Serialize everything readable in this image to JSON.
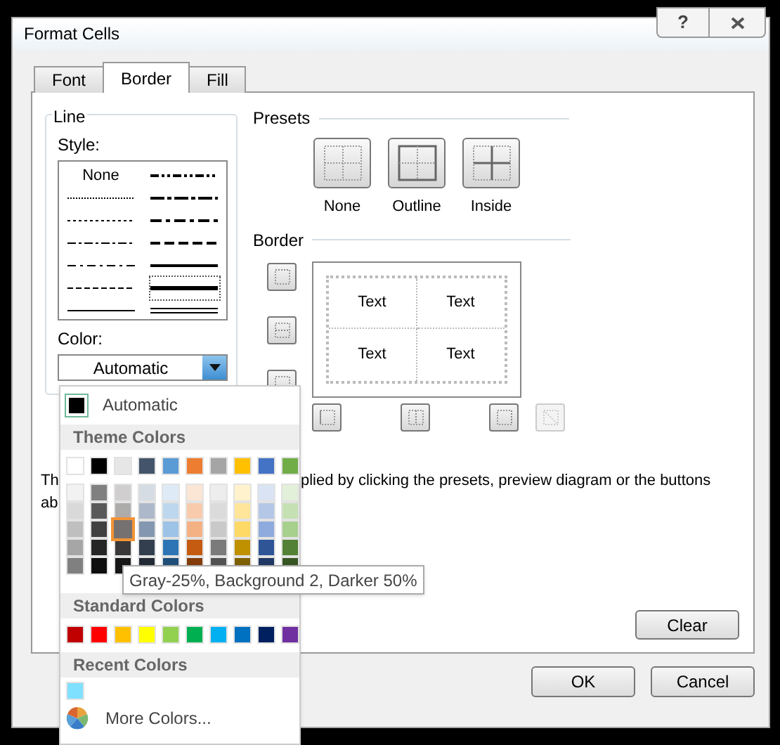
{
  "window": {
    "title": "Format Cells",
    "help": "?"
  },
  "tabs": [
    {
      "label": "Font",
      "selected": false
    },
    {
      "label": "Border",
      "selected": true
    },
    {
      "label": "Fill",
      "selected": false
    }
  ],
  "line": {
    "title": "Line",
    "style_label": "Style:",
    "styles": [
      {
        "kind": "none",
        "label": "None",
        "selected": false
      },
      {
        "kind": "dash-dot-dot",
        "selected": false
      },
      {
        "kind": "hair",
        "selected": false
      },
      {
        "kind": "medium-dash-dot-dot",
        "selected": false
      },
      {
        "kind": "dotted",
        "selected": false
      },
      {
        "kind": "medium-dash-dot",
        "selected": false
      },
      {
        "kind": "dash-dot-dot-thin",
        "selected": false
      },
      {
        "kind": "medium-dashed",
        "selected": false
      },
      {
        "kind": "dash-dot",
        "selected": false
      },
      {
        "kind": "medium",
        "selected": false
      },
      {
        "kind": "dashed",
        "selected": false
      },
      {
        "kind": "thick",
        "selected": true
      },
      {
        "kind": "thin",
        "selected": false
      },
      {
        "kind": "double",
        "selected": false
      }
    ],
    "color_label": "Color:",
    "color_value": "Automatic"
  },
  "presets": {
    "title": "Presets",
    "items": [
      {
        "kind": "none",
        "label": "None"
      },
      {
        "kind": "outline",
        "label": "Outline"
      },
      {
        "kind": "inside",
        "label": "Inside"
      }
    ]
  },
  "border": {
    "title": "Border",
    "side_buttons": [
      {
        "kind": "top",
        "disabled": false
      },
      {
        "kind": "middle",
        "disabled": false
      },
      {
        "kind": "bottom",
        "disabled": false
      }
    ],
    "bottom_buttons": [
      {
        "kind": "left",
        "disabled": false
      },
      {
        "kind": "center",
        "disabled": false
      },
      {
        "kind": "right",
        "disabled": false
      },
      {
        "kind": "diagonal",
        "disabled": true
      }
    ],
    "preview": [
      "Text",
      "Text",
      "Text",
      "Text"
    ]
  },
  "description": {
    "line_1_start": "Th",
    "line_1_end": "plied by clicking the presets, preview diagram or the buttons",
    "line_2_start": "ab"
  },
  "clear_button": "Clear",
  "buttons": [
    "OK",
    "Cancel"
  ],
  "color_menu": {
    "automatic": "Automatic",
    "theme_title": "Theme Colors",
    "theme_colors": [
      {
        "color": "#ffffff",
        "shades": [
          {
            "color": "#f2f2f2",
            "selected": false
          },
          {
            "color": "#d9d9d9",
            "selected": false
          },
          {
            "color": "#bfbfbf",
            "selected": false
          },
          {
            "color": "#a6a6a6",
            "selected": false
          },
          {
            "color": "#808080",
            "selected": false
          }
        ]
      },
      {
        "color": "#000000",
        "shades": [
          {
            "color": "#808080",
            "selected": false
          },
          {
            "color": "#595959",
            "selected": false
          },
          {
            "color": "#404040",
            "selected": false
          },
          {
            "color": "#262626",
            "selected": false
          },
          {
            "color": "#0d0d0d",
            "selected": false
          }
        ]
      },
      {
        "color": "#e7e6e6",
        "shades": [
          {
            "color": "#d0cece",
            "selected": false
          },
          {
            "color": "#aeabab",
            "selected": false
          },
          {
            "color": "#767171",
            "selected": true
          },
          {
            "color": "#3a3838",
            "selected": false
          },
          {
            "color": "#171616",
            "selected": false
          }
        ]
      },
      {
        "color": "#44546a",
        "shades": [
          {
            "color": "#d6dce4",
            "selected": false
          },
          {
            "color": "#adb9ca",
            "selected": false
          },
          {
            "color": "#8497b0",
            "selected": false
          },
          {
            "color": "#333f4f",
            "selected": false
          },
          {
            "color": "#222a35",
            "selected": false
          }
        ]
      },
      {
        "color": "#5b9bd5",
        "shades": [
          {
            "color": "#deebf6",
            "selected": false
          },
          {
            "color": "#bdd7ee",
            "selected": false
          },
          {
            "color": "#9dc3e6",
            "selected": false
          },
          {
            "color": "#2e75b5",
            "selected": false
          },
          {
            "color": "#1f4e79",
            "selected": false
          }
        ]
      },
      {
        "color": "#ed7d31",
        "shades": [
          {
            "color": "#fbe5d5",
            "selected": false
          },
          {
            "color": "#f7cbac",
            "selected": false
          },
          {
            "color": "#f4b183",
            "selected": false
          },
          {
            "color": "#c55a11",
            "selected": false
          },
          {
            "color": "#843c0b",
            "selected": false
          }
        ]
      },
      {
        "color": "#a5a5a5",
        "shades": [
          {
            "color": "#ededed",
            "selected": false
          },
          {
            "color": "#dbdbdb",
            "selected": false
          },
          {
            "color": "#c9c9c9",
            "selected": false
          },
          {
            "color": "#7b7b7b",
            "selected": false
          },
          {
            "color": "#525252",
            "selected": false
          }
        ]
      },
      {
        "color": "#ffc000",
        "shades": [
          {
            "color": "#fff2cc",
            "selected": false
          },
          {
            "color": "#fee599",
            "selected": false
          },
          {
            "color": "#ffd965",
            "selected": false
          },
          {
            "color": "#bf9000",
            "selected": false
          },
          {
            "color": "#7f6000",
            "selected": false
          }
        ]
      },
      {
        "color": "#4472c4",
        "shades": [
          {
            "color": "#dae3f3",
            "selected": false
          },
          {
            "color": "#b4c7e7",
            "selected": false
          },
          {
            "color": "#8faadc",
            "selected": false
          },
          {
            "color": "#2f5597",
            "selected": false
          },
          {
            "color": "#203864",
            "selected": false
          }
        ]
      },
      {
        "color": "#70ad47",
        "shades": [
          {
            "color": "#e2efd9",
            "selected": false
          },
          {
            "color": "#c5e0b3",
            "selected": false
          },
          {
            "color": "#a8d08d",
            "selected": false
          },
          {
            "color": "#538135",
            "selected": false
          },
          {
            "color": "#375623",
            "selected": false
          }
        ]
      }
    ],
    "standard_title": "Standard Colors",
    "standard_colors": [
      {
        "color": "#c00000"
      },
      {
        "color": "#ff0000"
      },
      {
        "color": "#ffc000"
      },
      {
        "color": "#ffff00"
      },
      {
        "color": "#92d050"
      },
      {
        "color": "#00b050"
      },
      {
        "color": "#00b0f0"
      },
      {
        "color": "#0070c0"
      },
      {
        "color": "#002060"
      },
      {
        "color": "#7030a0"
      }
    ],
    "recent_title": "Recent Colors",
    "recent_colors": [
      {
        "color": "#80e0ff"
      }
    ],
    "more": "More Colors...",
    "tooltip": "Gray-25%, Background 2, Darker 50%"
  }
}
